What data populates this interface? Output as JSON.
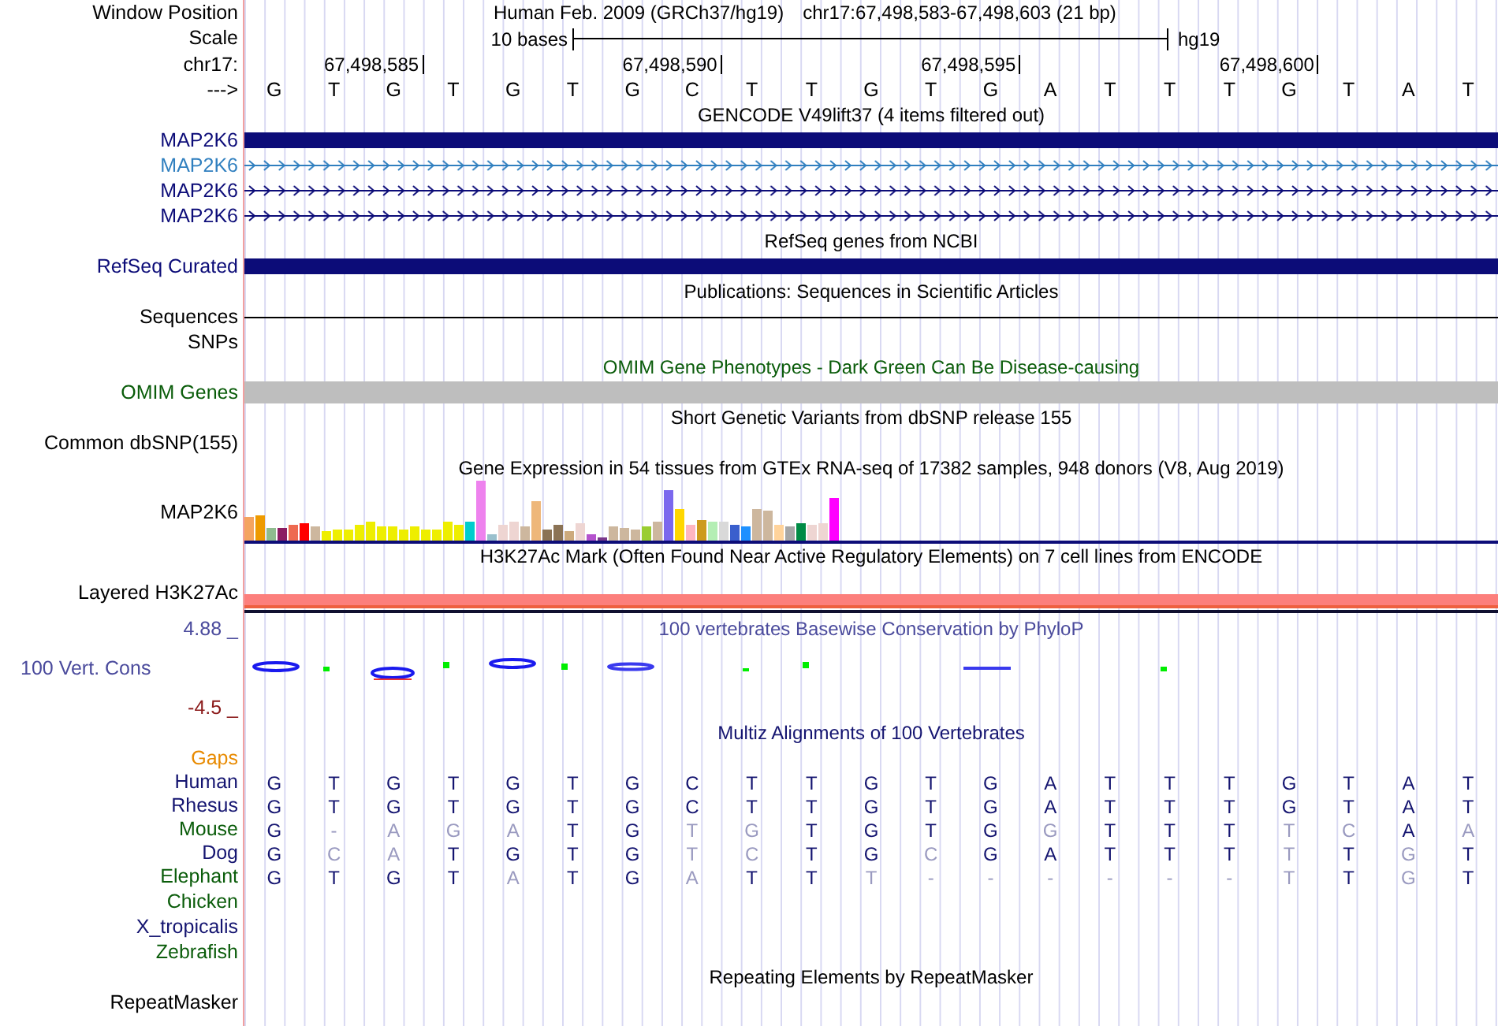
{
  "header": {
    "label": "Window Position",
    "assembly": "Human Feb. 2009 (GRCh37/hg19)",
    "position": "chr17:67,498,583-67,498,603 (21 bp)"
  },
  "scale": {
    "label": "Scale",
    "span": "10 bases",
    "assembly": "hg19"
  },
  "ruler": {
    "label": "chr17:",
    "ticks": [
      "67,498,585",
      "67,498,590",
      "67,498,595",
      "67,498,600"
    ]
  },
  "sequence": {
    "label": "--->",
    "bases": [
      "G",
      "T",
      "G",
      "T",
      "G",
      "T",
      "G",
      "C",
      "T",
      "T",
      "G",
      "T",
      "G",
      "A",
      "T",
      "T",
      "T",
      "G",
      "T",
      "A",
      "T"
    ]
  },
  "tracks": [
    {
      "title": "GENCODE V49lift37 (4 items filtered out)",
      "color": "#000000",
      "rows": [
        {
          "kind": "block",
          "label": "MAP2K6",
          "color": "#0c0c78"
        },
        {
          "kind": "arrows",
          "label": "MAP2K6",
          "color": "#2f7fbf"
        },
        {
          "kind": "arrows",
          "label": "MAP2K6",
          "color": "#0c0c78"
        },
        {
          "kind": "arrows",
          "label": "MAP2K6",
          "color": "#0c0c78"
        }
      ]
    },
    {
      "title": "RefSeq genes from NCBI",
      "color": "#000000",
      "rows": [
        {
          "kind": "block",
          "label": "RefSeq Curated",
          "color": "#0c0c78"
        }
      ]
    },
    {
      "title": "Publications: Sequences in Scientific Articles",
      "color": "#000000",
      "rows": [
        {
          "kind": "line",
          "label": "Sequences",
          "color": "#000000"
        },
        {
          "kind": "empty",
          "label": "SNPs",
          "color": "#000000"
        }
      ]
    },
    {
      "title": "OMIM Gene Phenotypes - Dark Green Can Be Disease-causing",
      "color": "#0a5c0a",
      "rows": [
        {
          "kind": "gray",
          "label": "OMIM Genes",
          "color": "#0a5c0a"
        }
      ]
    },
    {
      "title": "Short Genetic Variants from dbSNP release 155",
      "color": "#000000",
      "rows": [
        {
          "kind": "empty",
          "label": "Common dbSNP(155)",
          "color": "#000000"
        }
      ]
    },
    {
      "title": "Gene Expression in 54 tissues from GTEx RNA-seq of 17382 samples, 948 donors (V8, Aug 2019)",
      "color": "#000000",
      "rows": [
        {
          "kind": "bars",
          "label": "MAP2K6",
          "color": "#000000"
        }
      ]
    },
    {
      "title": "H3K27Ac Mark (Often Found Near Active Regulatory Elements) on 7 cell lines from ENCODE",
      "color": "#000000",
      "rows": [
        {
          "kind": "layered",
          "label": "Layered H3K27Ac",
          "color": "#000000"
        }
      ]
    },
    {
      "title": "100 vertebrates Basewise Conservation by PhyloP",
      "color": "#4a4a9c",
      "rows": [
        {
          "kind": "wiggle",
          "label": "100 Vert. Cons",
          "color": "#4a4a9c",
          "max": "4.88 _",
          "min": "-4.5 _"
        }
      ]
    },
    {
      "title": "Multiz Alignments of 100 Vertebrates",
      "color": "#141470",
      "rows": [
        {
          "kind": "empty",
          "label": "Gaps",
          "color": "#e88a00"
        },
        {
          "kind": "bases",
          "label": "Human",
          "color": "#141470",
          "bases": [
            {
              "base": "G",
              "faded": false
            },
            {
              "base": "T",
              "faded": false
            },
            {
              "base": "G",
              "faded": false
            },
            {
              "base": "T",
              "faded": false
            },
            {
              "base": "G",
              "faded": false
            },
            {
              "base": "T",
              "faded": false
            },
            {
              "base": "G",
              "faded": false
            },
            {
              "base": "C",
              "faded": false
            },
            {
              "base": "T",
              "faded": false
            },
            {
              "base": "T",
              "faded": false
            },
            {
              "base": "G",
              "faded": false
            },
            {
              "base": "T",
              "faded": false
            },
            {
              "base": "G",
              "faded": false
            },
            {
              "base": "A",
              "faded": false
            },
            {
              "base": "T",
              "faded": false
            },
            {
              "base": "T",
              "faded": false
            },
            {
              "base": "T",
              "faded": false
            },
            {
              "base": "G",
              "faded": false
            },
            {
              "base": "T",
              "faded": false
            },
            {
              "base": "A",
              "faded": false
            },
            {
              "base": "T",
              "faded": false
            }
          ]
        },
        {
          "kind": "bases",
          "label": "Rhesus",
          "color": "#141470",
          "bases": [
            {
              "base": "G",
              "faded": false
            },
            {
              "base": "T",
              "faded": false
            },
            {
              "base": "G",
              "faded": false
            },
            {
              "base": "T",
              "faded": false
            },
            {
              "base": "G",
              "faded": false
            },
            {
              "base": "T",
              "faded": false
            },
            {
              "base": "G",
              "faded": false
            },
            {
              "base": "C",
              "faded": false
            },
            {
              "base": "T",
              "faded": false
            },
            {
              "base": "T",
              "faded": false
            },
            {
              "base": "G",
              "faded": false
            },
            {
              "base": "T",
              "faded": false
            },
            {
              "base": "G",
              "faded": false
            },
            {
              "base": "A",
              "faded": false
            },
            {
              "base": "T",
              "faded": false
            },
            {
              "base": "T",
              "faded": false
            },
            {
              "base": "T",
              "faded": false
            },
            {
              "base": "G",
              "faded": false
            },
            {
              "base": "T",
              "faded": false
            },
            {
              "base": "A",
              "faded": false
            },
            {
              "base": "T",
              "faded": false
            }
          ]
        },
        {
          "kind": "bases",
          "label": "Mouse",
          "color": "#0a5c0a",
          "bases": [
            {
              "base": "G",
              "faded": false
            },
            {
              "base": "-",
              "faded": true
            },
            {
              "base": "A",
              "faded": true
            },
            {
              "base": "G",
              "faded": true
            },
            {
              "base": "A",
              "faded": true
            },
            {
              "base": "T",
              "faded": false
            },
            {
              "base": "G",
              "faded": false
            },
            {
              "base": "T",
              "faded": true
            },
            {
              "base": "G",
              "faded": true
            },
            {
              "base": "T",
              "faded": false
            },
            {
              "base": "G",
              "faded": false
            },
            {
              "base": "T",
              "faded": false
            },
            {
              "base": "G",
              "faded": false
            },
            {
              "base": "G",
              "faded": true
            },
            {
              "base": "T",
              "faded": false
            },
            {
              "base": "T",
              "faded": false
            },
            {
              "base": "T",
              "faded": false
            },
            {
              "base": "T",
              "faded": true
            },
            {
              "base": "C",
              "faded": true
            },
            {
              "base": "A",
              "faded": false
            },
            {
              "base": "A",
              "faded": true
            }
          ]
        },
        {
          "kind": "bases",
          "label": "Dog",
          "color": "#141470",
          "bases": [
            {
              "base": "G",
              "faded": false
            },
            {
              "base": "C",
              "faded": true
            },
            {
              "base": "A",
              "faded": true
            },
            {
              "base": "T",
              "faded": false
            },
            {
              "base": "G",
              "faded": false
            },
            {
              "base": "T",
              "faded": false
            },
            {
              "base": "G",
              "faded": false
            },
            {
              "base": "T",
              "faded": true
            },
            {
              "base": "C",
              "faded": true
            },
            {
              "base": "T",
              "faded": false
            },
            {
              "base": "G",
              "faded": false
            },
            {
              "base": "C",
              "faded": true
            },
            {
              "base": "G",
              "faded": false
            },
            {
              "base": "A",
              "faded": false
            },
            {
              "base": "T",
              "faded": false
            },
            {
              "base": "T",
              "faded": false
            },
            {
              "base": "T",
              "faded": false
            },
            {
              "base": "T",
              "faded": true
            },
            {
              "base": "T",
              "faded": false
            },
            {
              "base": "G",
              "faded": true
            },
            {
              "base": "T",
              "faded": false
            }
          ]
        },
        {
          "kind": "bases",
          "label": "Elephant",
          "color": "#0a5c0a",
          "bases": [
            {
              "base": "G",
              "faded": false
            },
            {
              "base": "T",
              "faded": false
            },
            {
              "base": "G",
              "faded": false
            },
            {
              "base": "T",
              "faded": false
            },
            {
              "base": "A",
              "faded": true
            },
            {
              "base": "T",
              "faded": false
            },
            {
              "base": "G",
              "faded": false
            },
            {
              "base": "A",
              "faded": true
            },
            {
              "base": "T",
              "faded": false
            },
            {
              "base": "T",
              "faded": false
            },
            {
              "base": "T",
              "faded": true
            },
            {
              "base": "-",
              "faded": true
            },
            {
              "base": "-",
              "faded": true
            },
            {
              "base": "-",
              "faded": true
            },
            {
              "base": "-",
              "faded": true
            },
            {
              "base": "-",
              "faded": true
            },
            {
              "base": "-",
              "faded": true
            },
            {
              "base": "T",
              "faded": true
            },
            {
              "base": "T",
              "faded": false
            },
            {
              "base": "G",
              "faded": true
            },
            {
              "base": "T",
              "faded": false
            }
          ]
        },
        {
          "kind": "empty",
          "label": "Chicken",
          "color": "#0a5c0a"
        },
        {
          "kind": "empty",
          "label": "X_tropicalis",
          "color": "#141470"
        },
        {
          "kind": "empty",
          "label": "Zebrafish",
          "color": "#0a5c0a"
        }
      ]
    },
    {
      "title": "Repeating Elements by RepeatMasker",
      "color": "#000000",
      "rows": [
        {
          "kind": "empty",
          "label": "RepeatMasker",
          "color": "#000000"
        }
      ]
    }
  ]
}
